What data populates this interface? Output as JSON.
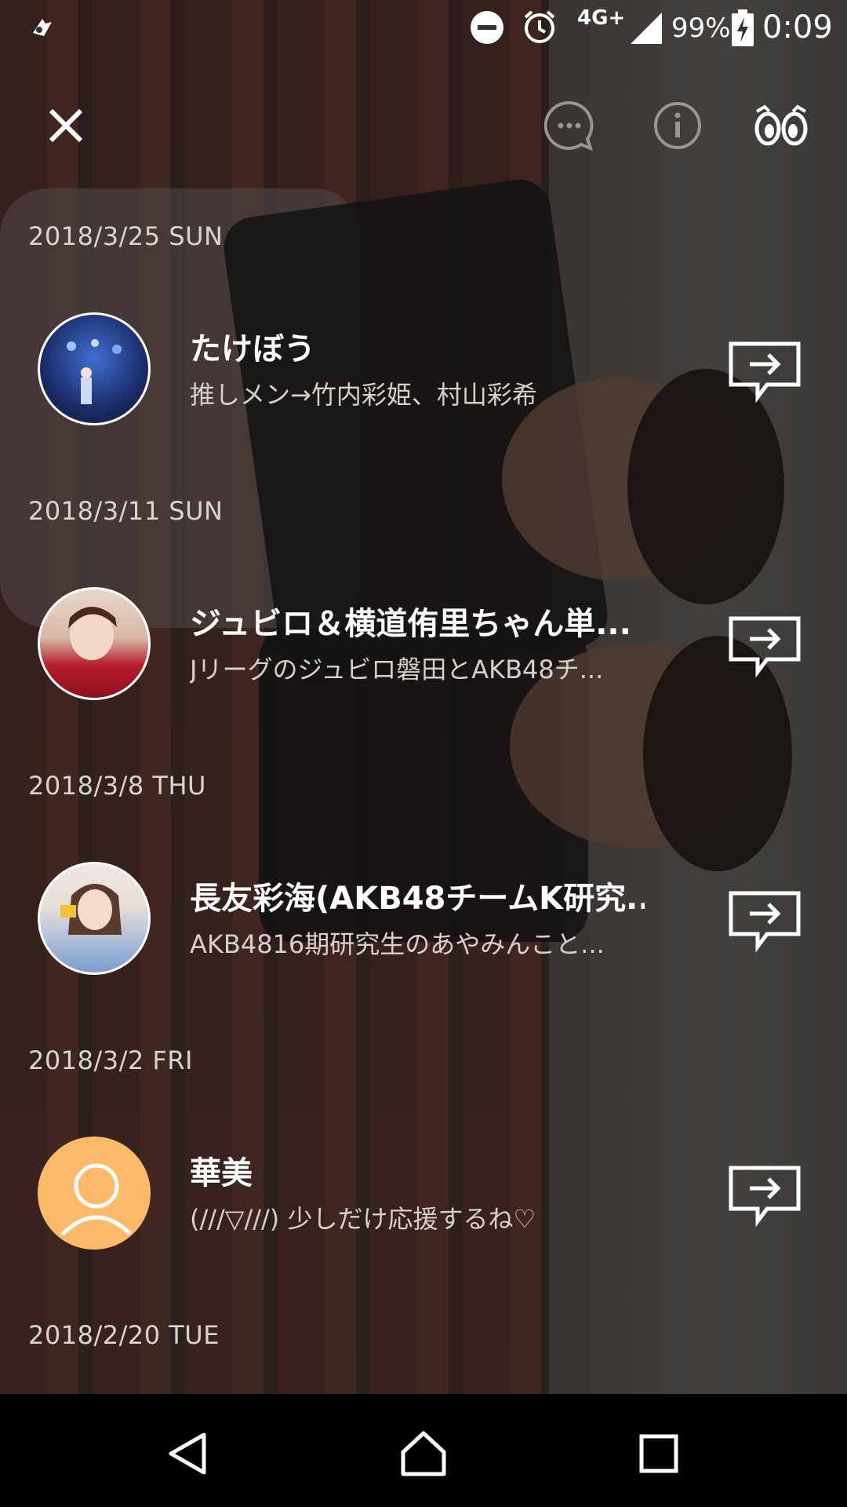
{
  "status_bar": {
    "network": "4G+",
    "battery": "99%",
    "time": "0:09",
    "icons": [
      "app-notification-icon",
      "do-not-disturb-icon",
      "alarm-icon",
      "signal-icon",
      "battery-charging-icon"
    ]
  },
  "toolbar": {
    "icons": [
      "close-icon",
      "comment-icon",
      "info-icon",
      "eyes-icon"
    ]
  },
  "entries": [
    {
      "date": "2018/3/25 SUN",
      "name": "たけぼう",
      "text": "推しメン→竹内彩姫、村山彩希",
      "avatar": "stage-photo"
    },
    {
      "date": "2018/3/11 SUN",
      "name": "ジュビロ＆横道侑里ちゃん単...",
      "text": "Jリーグのジュビロ磐田とAKB48チ...",
      "avatar": "girl-red-photo"
    },
    {
      "date": "2018/3/8 THU",
      "name": "長友彩海(AKB48チームK研究...",
      "text": "AKB4816期研究生のあやみんこと...",
      "avatar": "girl-blue-photo"
    },
    {
      "date": "2018/3/2 FRI",
      "name": "華美",
      "text": "(///▽///) 少しだけ応援するね♡",
      "avatar": "default-user",
      "avatar_color": "#FDB96A"
    }
  ],
  "trailing_date": "2018/2/20 TUE",
  "nav": [
    "back-icon",
    "home-icon",
    "recents-icon"
  ]
}
